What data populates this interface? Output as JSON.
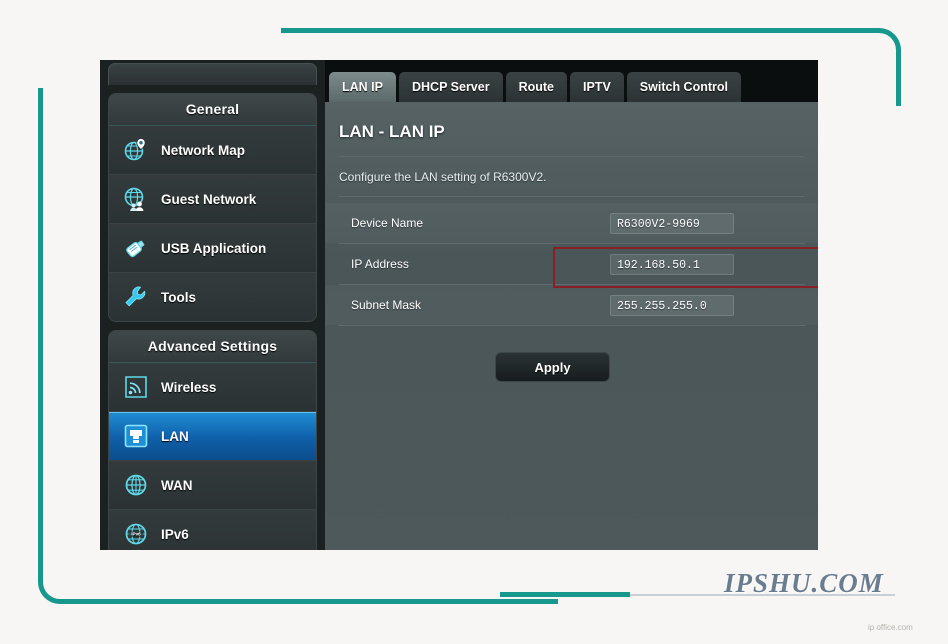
{
  "frame": {
    "accent_color": "#16988c"
  },
  "sidebar": {
    "groups": [
      {
        "title": "General",
        "items": [
          {
            "label": "Network Map",
            "icon": "globe-pin-icon",
            "active": false
          },
          {
            "label": "Guest Network",
            "icon": "globe-users-icon",
            "active": false
          },
          {
            "label": "USB Application",
            "icon": "usb-drive-icon",
            "active": false
          },
          {
            "label": "Tools",
            "icon": "wrench-icon",
            "active": false
          }
        ]
      },
      {
        "title": "Advanced Settings",
        "items": [
          {
            "label": "Wireless",
            "icon": "wifi-signal-icon",
            "active": false
          },
          {
            "label": "LAN",
            "icon": "lan-port-icon",
            "active": true
          },
          {
            "label": "WAN",
            "icon": "globe-grid-icon",
            "active": false
          },
          {
            "label": "IPv6",
            "icon": "globe-ipv6-icon",
            "active": false
          }
        ]
      }
    ]
  },
  "tabs": [
    {
      "label": "LAN IP",
      "active": true
    },
    {
      "label": "DHCP Server",
      "active": false
    },
    {
      "label": "Route",
      "active": false
    },
    {
      "label": "IPTV",
      "active": false
    },
    {
      "label": "Switch Control",
      "active": false
    }
  ],
  "main": {
    "title": "LAN - LAN IP",
    "description": "Configure the LAN setting of R6300V2.",
    "rows": [
      {
        "label": "Device Name",
        "value": "R6300V2-9969",
        "highlighted": false
      },
      {
        "label": "IP Address",
        "value": "192.168.50.1",
        "highlighted": true
      },
      {
        "label": "Subnet Mask",
        "value": "255.255.255.0",
        "highlighted": false
      }
    ],
    "apply_label": "Apply",
    "highlight_color": "#8b1f26"
  },
  "watermark": {
    "text": "IPSHU.COM",
    "small_text": "ip office.com"
  }
}
